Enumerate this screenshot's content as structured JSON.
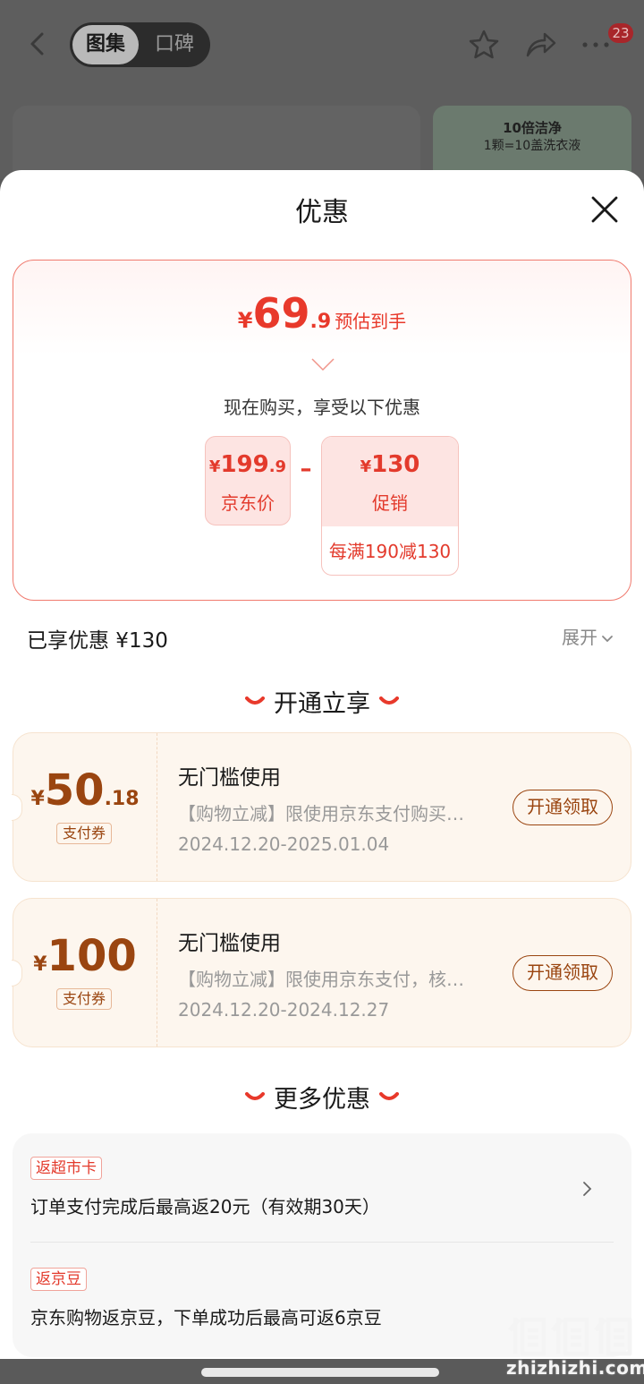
{
  "background": {
    "tabs": [
      "图集",
      "口碑"
    ],
    "badge_count": "23",
    "promo_line_1": "10倍洁净",
    "promo_line_2": "1颗=10盖洗衣液"
  },
  "sheet": {
    "title": "优惠"
  },
  "estimate": {
    "currency": "¥",
    "integer": "69",
    "decimal": ".9",
    "label": "预估到手"
  },
  "breakdown": {
    "intro": "现在购买，享受以下优惠",
    "jd_price": {
      "currency": "¥",
      "integer": "199",
      "decimal": ".9",
      "label": "京东价"
    },
    "operator": "–",
    "promotion": {
      "currency": "¥",
      "amount": "130",
      "label": "促销",
      "rule": "每满190减130"
    }
  },
  "summary": {
    "enjoyed": "已享优惠 ¥130",
    "expand_label": "展开"
  },
  "open_section": {
    "title": "开通立享",
    "coupons": [
      {
        "currency": "¥",
        "integer": "50",
        "decimal": ".18",
        "tag": "支付券",
        "title": "无门槛使用",
        "description": "【购物立减】限使用京东支付购买…",
        "date_range": "2024.12.20-2025.01.04",
        "button": "开通领取"
      },
      {
        "currency": "¥",
        "integer": "100",
        "decimal": "",
        "tag": "支付券",
        "title": "无门槛使用",
        "description": "【购物立减】限使用京东支付，核…",
        "date_range": "2024.12.20-2024.12.27",
        "button": "开通领取"
      }
    ]
  },
  "more_section": {
    "title": "更多优惠",
    "items": [
      {
        "tag": "返超市卡",
        "text": "订单支付完成后最高返20元（有效期30天）"
      },
      {
        "tag": "返京豆",
        "text": "京东购物返京豆，下单成功后最高可返6京豆"
      }
    ]
  },
  "watermark": {
    "site": "zhizhizhi.com"
  },
  "colors": {
    "accent_red": "#e8392b",
    "coupon_brown": "#9a4510",
    "coupon_bg": "#fdf6ee"
  }
}
